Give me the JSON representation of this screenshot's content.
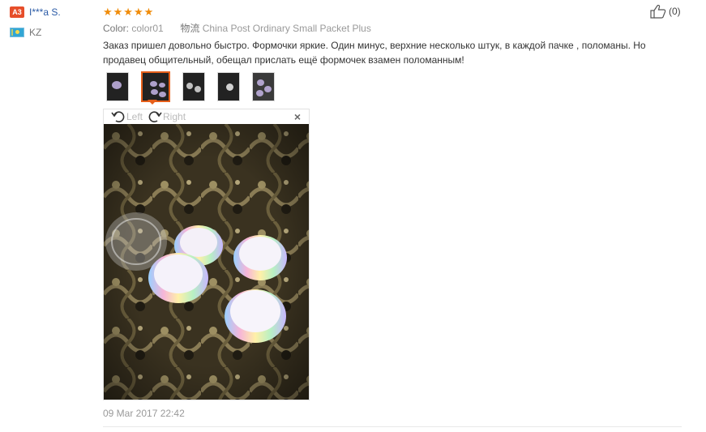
{
  "user": {
    "badge": "A3",
    "name": "I***a S.",
    "country": "KZ"
  },
  "review": {
    "rating": 5,
    "stars_text": "★★★★★",
    "color_label": "Color:",
    "color_value": "color01",
    "shipping_label": "物流",
    "shipping_value": "China Post Ordinary Small Packet Plus",
    "text": "Заказ пришел довольно быстро. Формочки яркие. Один минус, верхние несколько штук, в каждой пачке , поломаны. Но продавец общительный, обещал прислать ещё формочек взамен поломанным!",
    "helpful_count": "(0)",
    "date": "09 Mar 2017 22:42",
    "thumbnails_count": 5,
    "active_thumbnail": 2
  },
  "viewer": {
    "rotate_left": "Left",
    "rotate_right": "Right",
    "close": "×"
  },
  "colors": {
    "star": "#f08c0a",
    "link": "#2a5aa6",
    "active_thumb_border": "#e65f1a",
    "badge": "#e64e2a"
  }
}
